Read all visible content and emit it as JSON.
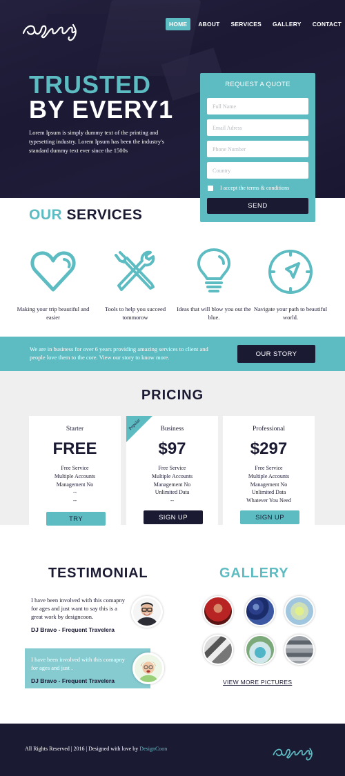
{
  "colors": {
    "accent": "#5cbcc2",
    "dark": "#1b1a33",
    "light": "#efefef"
  },
  "brand": {
    "logo_text": "agency"
  },
  "nav": {
    "items": [
      {
        "label": "HOME",
        "active": true
      },
      {
        "label": "ABOUT"
      },
      {
        "label": "SERVICES"
      },
      {
        "label": "GALLERY"
      },
      {
        "label": "CONTACT"
      }
    ]
  },
  "hero": {
    "title_line1": "TRUSTED",
    "title_line2": "BY EVERY1",
    "description": "Lorem Ipsum is simply dummy text of the printing and typesetting industry. Lorem Ipsum has been the industry's standard dummy text ever since the 1500s"
  },
  "quote_form": {
    "title": "REQUEST A QUOTE",
    "full_name_placeholder": "Full Name",
    "email_placeholder": "Email Adress",
    "phone_placeholder": "Phone Number",
    "country_placeholder": "Country",
    "terms_label": "I accept the terms & conditions",
    "send_label": "SEND"
  },
  "services": {
    "title_accent": "OUR",
    "title_rest": "SERVICES",
    "items": [
      {
        "icon": "heart-icon",
        "caption": "Making your trip beautiful and easier"
      },
      {
        "icon": "tools-icon",
        "caption": "Tools to help you succeed tommorow"
      },
      {
        "icon": "lightbulb-icon",
        "caption": "Ideas that will blow you out the blue."
      },
      {
        "icon": "compass-icon",
        "caption": "Navigate your path to beautiful world."
      }
    ]
  },
  "story": {
    "text": "We are in business for over 6 years providing amazing services to client and people love them to the core. View our story to know more.",
    "button_label": "OUR STORY"
  },
  "pricing": {
    "title": "PRICING",
    "plans": [
      {
        "name": "Starter",
        "price": "FREE",
        "features": [
          "Free Service",
          "Multiple Accounts",
          "Management No",
          "--",
          "--"
        ],
        "cta": "TRY"
      },
      {
        "name": "Business",
        "price": "$97",
        "badge": "Popular",
        "features": [
          "Free Service",
          "Multiple Accounts",
          "Management No",
          "Unlimited Data",
          "--"
        ],
        "cta": "SIGN UP"
      },
      {
        "name": "Professional",
        "price": "$297",
        "features": [
          "Free Service",
          "Multiple Accounts",
          "Management No",
          "Unlimited Data",
          "Whatever You Need"
        ],
        "cta": "SIGN UP"
      }
    ]
  },
  "testimonial": {
    "title": "TESTIMONIAL",
    "items": [
      {
        "text": "I have been involved with this comapny for ages and just want to say this is a great work by designcoon.",
        "author": "DJ Bravo - Frequent Travelera"
      },
      {
        "text": "I have been involved with this comapny for ages and just .",
        "author": "DJ Bravo - Frequent Travelera"
      }
    ]
  },
  "gallery": {
    "title": "GALLERY",
    "more_label": "VIEW MORE PICTURES"
  },
  "footer": {
    "copy": "All Rights Reserved | 2016 | Designed with love by",
    "link": "DesignCoon"
  }
}
